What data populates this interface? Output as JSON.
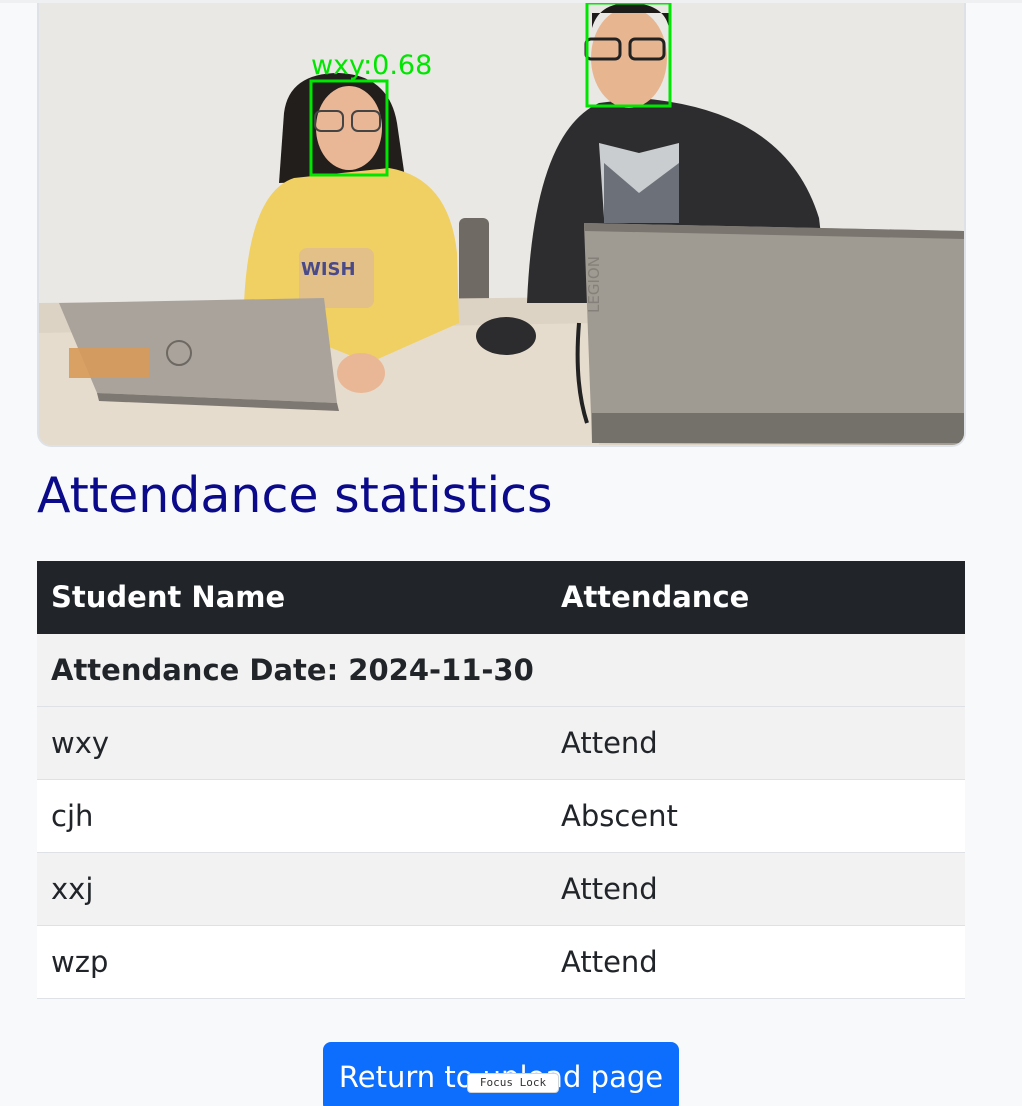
{
  "photo": {
    "detection_label": "wxy:0.68",
    "box_color": "#00ff00"
  },
  "heading": {
    "title": "Attendance statistics"
  },
  "table": {
    "headers": {
      "name": "Student Name",
      "attendance": "Attendance"
    },
    "date_row": "Attendance Date: 2024-11-30",
    "rows": [
      {
        "name": "wxy",
        "status": "Attend"
      },
      {
        "name": "cjh",
        "status": "Abscent"
      },
      {
        "name": "xxj",
        "status": "Attend"
      },
      {
        "name": "wzp",
        "status": "Attend"
      }
    ]
  },
  "actions": {
    "return_label": "Return to upload page",
    "focus_lock_label": "Focus Lock"
  },
  "colors": {
    "title": "#0a0a8a",
    "header_bg": "#212529",
    "button_bg": "#0d6efd"
  }
}
